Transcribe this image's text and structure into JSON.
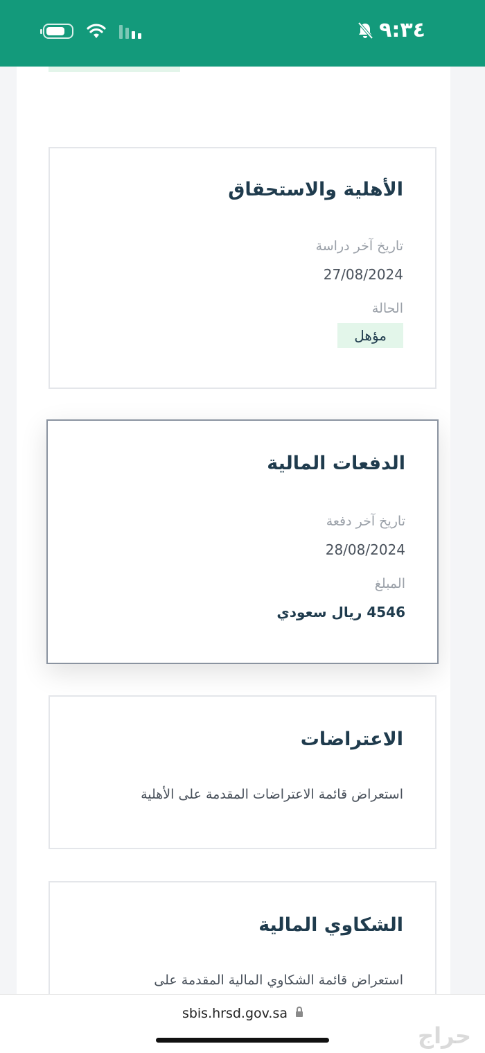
{
  "status_bar": {
    "time": "٩:٣٤",
    "bell_muted": "bell-slash-icon",
    "battery": "battery-icon",
    "wifi": "wifi-icon",
    "signal": "cellular-signal-icon"
  },
  "eligibility_card": {
    "title": "الأهلية والاستحقاق",
    "last_study_label": "تاريخ آخر دراسة",
    "last_study_value": "27/08/2024",
    "status_label": "الحالة",
    "status_value": "مؤهل"
  },
  "payments_card": {
    "title": "الدفعات المالية",
    "last_payment_label": "تاريخ آخر دفعة",
    "last_payment_value": "28/08/2024",
    "amount_label": "المبلغ",
    "amount_value": "4546 ريال سعودي"
  },
  "objections_card": {
    "title": "الاعتراضات",
    "description": "استعراض قائمة الاعتراضات المقدمة على الأهلية"
  },
  "complaints_card": {
    "title": "الشكاوي المالية",
    "description": "استعراض قائمة الشكاوي المالية المقدمة على"
  },
  "browser": {
    "url": "sbis.hrsd.gov.sa"
  },
  "watermark": "حراج",
  "colors": {
    "header_green": "#139a7b",
    "badge_green": "#e3f6ea",
    "title_navy": "#1f3b4d"
  }
}
